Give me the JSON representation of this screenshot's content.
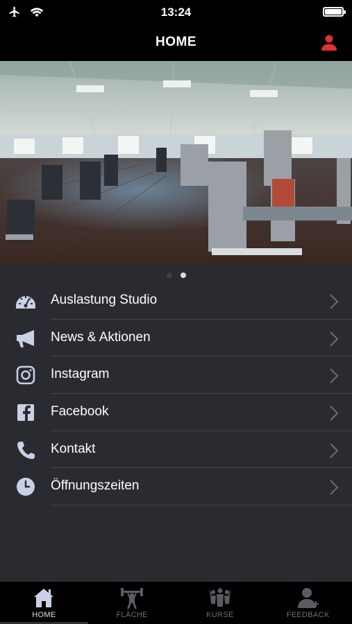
{
  "status_bar": {
    "time": "13:24"
  },
  "nav": {
    "title": "HOME"
  },
  "carousel": {
    "pages": 2,
    "active": 2
  },
  "menu": [
    {
      "label": "Auslastung Studio",
      "icon": "speedometer-icon"
    },
    {
      "label": "News & Aktionen",
      "icon": "megaphone-icon"
    },
    {
      "label": "Instagram",
      "icon": "instagram-icon"
    },
    {
      "label": "Facebook",
      "icon": "facebook-icon"
    },
    {
      "label": "Kontakt",
      "icon": "phone-icon"
    },
    {
      "label": "Öffnungszeiten",
      "icon": "clock-icon"
    }
  ],
  "tabs": [
    {
      "label": "HOME",
      "icon": "home-icon",
      "active": true
    },
    {
      "label": "FLÄCHE",
      "icon": "weightlifter-icon",
      "active": false
    },
    {
      "label": "KURSE",
      "icon": "group-class-icon",
      "active": false
    },
    {
      "label": "FEEDBACK",
      "icon": "user-add-icon",
      "active": false
    }
  ],
  "colors": {
    "accent": "#e03030",
    "menu_icon": "#c9d0e8",
    "background": "#2a2b30"
  }
}
